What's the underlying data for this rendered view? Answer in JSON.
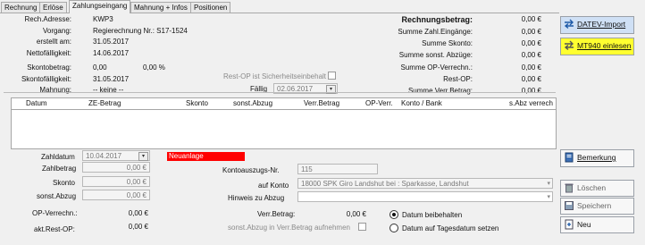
{
  "tabs": [
    "Rechnung",
    "Erlöse",
    "Zahlungseingang",
    "Mahnung + Infos",
    "Positionen"
  ],
  "left_info": [
    {
      "label": "Rech.Adresse:",
      "value": "KWP3"
    },
    {
      "label": "Vorgang:",
      "value": "Regierechnung Nr.: S17-1524"
    },
    {
      "label": "erstellt am:",
      "value": "31.05.2017"
    },
    {
      "label": "Nettofälligkeit:",
      "value": "14.06.2017"
    },
    {
      "label": "Skontobetrag:",
      "value": "0,00"
    },
    {
      "label": "Skontofälligkeit:",
      "value": "31.05.2017"
    },
    {
      "label": "Mahnung:",
      "value": "-- keine --"
    }
  ],
  "skonto_percent": "0,00 %",
  "rest_op_label": "Rest-OP ist Sicherheitseinbehalt",
  "faellig": {
    "label": "Fällig",
    "value": "02.06.2017"
  },
  "summary": [
    {
      "label": "Rechnungsbetrag:",
      "value": "0,00 €"
    },
    {
      "label": "Summe Zahl.Eingänge:",
      "value": "0,00 €"
    },
    {
      "label": "Summe Skonto:",
      "value": "0,00 €"
    },
    {
      "label": "Summe sonst. Abzüge:",
      "value": "0,00 €"
    },
    {
      "label": "Summe OP-Verrechn.:",
      "value": "0,00 €"
    },
    {
      "label": "Rest-OP:",
      "value": "0,00 €"
    },
    {
      "label": "Summe Verr.Betrag:",
      "value": "0,00 €"
    }
  ],
  "buttons": {
    "datev": "DATEV-Import",
    "mt940": "MT940 einlesen",
    "bemerkung": "Bemerkung",
    "loeschen": "Löschen",
    "speichern": "Speichern",
    "neu": "Neu"
  },
  "grid_columns": [
    "Datum",
    "ZE-Betrag",
    "Skonto",
    "sonst.Abzug",
    "Verr.Betrag",
    "OP-Verr.",
    "Konto / Bank",
    "s.Abz verrech"
  ],
  "form": {
    "zahldatum_label": "Zahldatum",
    "zahldatum": "10.04.2017",
    "zahlbetrag_label": "Zahlbetrag",
    "zahlbetrag": "0,00 €",
    "skonto_label": "Skonto",
    "skonto": "0,00 €",
    "sonst_abzug_label": "sonst.Abzug",
    "sonst_abzug": "0,00 €",
    "op_verrechn_label": "OP-Verrechn.:",
    "op_verrechn": "0,00 €",
    "akt_rest_op_label": "akt.Rest-OP:",
    "akt_rest_op": "0,00 €",
    "status": "Neuanlage",
    "kontoauszug_label": "Kontoauszugs-Nr.",
    "kontoauszug": "115",
    "auf_konto_label": "auf Konto",
    "auf_konto": "18000 SPK Giro Landshut    bei : Sparkasse, Landshut",
    "hinweis_label": "Hinweis zu Abzug",
    "hinweis": "",
    "verr_betrag_label": "Verr.Betrag:",
    "verr_betrag": "0,00 €",
    "sonst_abzug_verr_label": "sonst.Abzug in Verr.Betrag aufnehmen",
    "radio1": "Datum beibehalten",
    "radio2": "Datum auf Tagesdatum setzen"
  },
  "colors": {
    "status_red": "#ff0000",
    "mt940_yellow": "#ffff30",
    "datev_blue": "#cfe0f5"
  }
}
